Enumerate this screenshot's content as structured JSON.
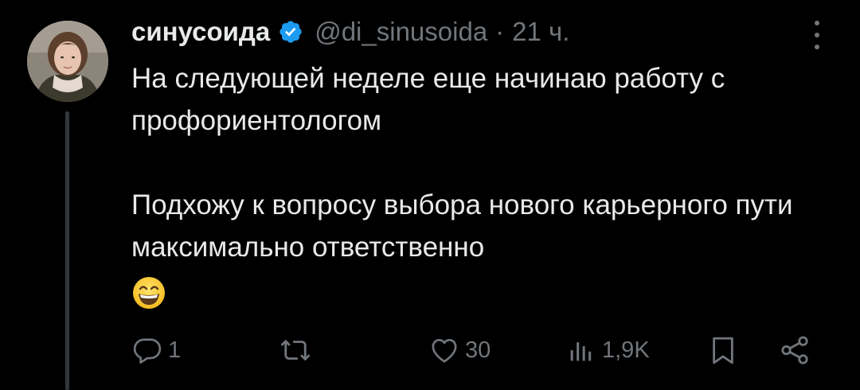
{
  "tweet": {
    "author": {
      "display_name": "синусоида",
      "handle": "@di_sinusoida",
      "verified": true,
      "avatar_icon": "user-avatar"
    },
    "separator": "·",
    "time": "21 ч.",
    "more_icon": "more-vertical-icon",
    "text_paragraphs": [
      "На следующей неделе еще начинаю работу с профориентологом",
      "Подхожу к вопросу выбора нового карьерного пути максимально ответственно"
    ],
    "emoji": "grinning-face-with-smiling-eyes"
  },
  "actions": {
    "reply": {
      "icon": "reply-icon",
      "count": "1"
    },
    "retweet": {
      "icon": "retweet-icon",
      "count": ""
    },
    "like": {
      "icon": "heart-icon",
      "count": "30"
    },
    "views": {
      "icon": "views-icon",
      "count": "1,9K"
    },
    "bookmark": {
      "icon": "bookmark-icon"
    },
    "share": {
      "icon": "share-icon"
    }
  },
  "colors": {
    "background": "#000000",
    "text_primary": "#e7e9ea",
    "text_secondary": "#71767b",
    "verified_badge": "#1d9bf0",
    "thread_line": "#333639"
  }
}
